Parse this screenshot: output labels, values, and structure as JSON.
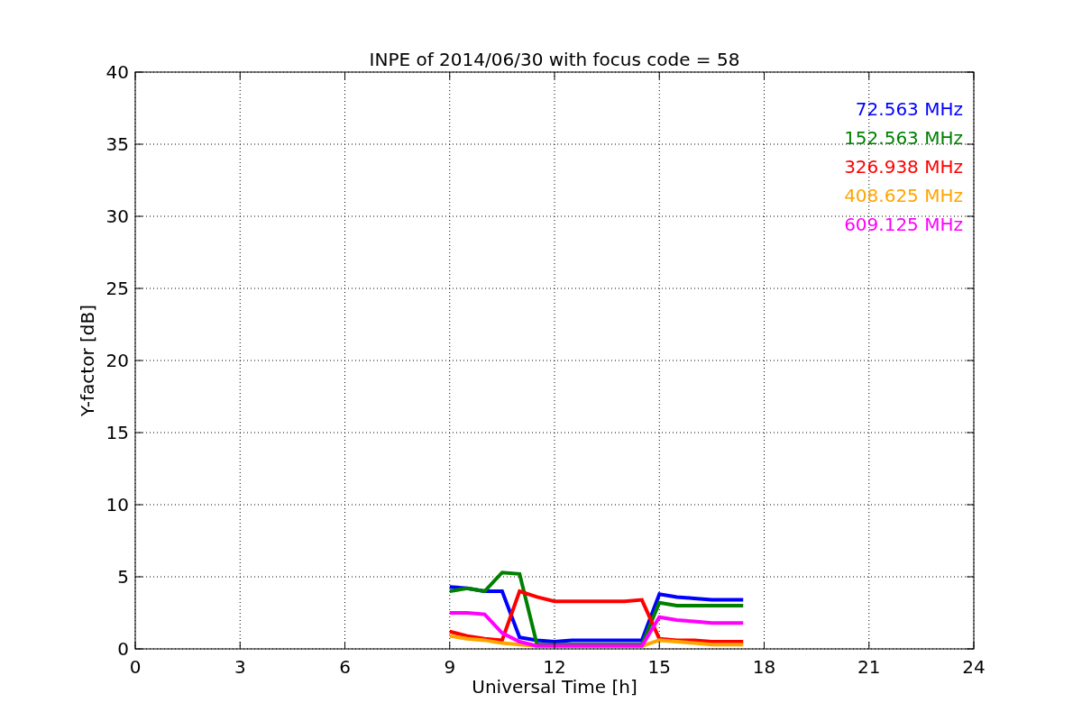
{
  "chart_data": {
    "type": "line",
    "title": "INPE of 2014/06/30 with focus code = 58",
    "xlabel": "Universal Time [h]",
    "ylabel": "Y-factor [dB]",
    "x": [
      9,
      9.5,
      10,
      10.5,
      11,
      11.5,
      12,
      12.5,
      13,
      13.5,
      14,
      14.5,
      15,
      15.5,
      16,
      16.5,
      17,
      17.4
    ],
    "series": [
      {
        "name": "72.563 MHz",
        "color": "#0000ff",
        "values": [
          4.3,
          4.2,
          4.0,
          4.0,
          0.8,
          0.6,
          0.5,
          0.6,
          0.6,
          0.6,
          0.6,
          0.6,
          3.8,
          3.6,
          3.5,
          3.4,
          3.4,
          3.4
        ]
      },
      {
        "name": "152.563 MHz",
        "color": "#008000",
        "values": [
          4.0,
          4.2,
          4.0,
          5.3,
          5.2,
          0.3,
          0.3,
          0.3,
          0.3,
          0.3,
          0.3,
          0.3,
          3.2,
          3.0,
          3.0,
          3.0,
          3.0,
          3.0
        ]
      },
      {
        "name": "326.938 MHz",
        "color": "#ff0000",
        "values": [
          1.2,
          0.9,
          0.7,
          0.6,
          4.0,
          3.6,
          3.3,
          3.3,
          3.3,
          3.3,
          3.3,
          3.4,
          0.7,
          0.6,
          0.6,
          0.5,
          0.5,
          0.5
        ]
      },
      {
        "name": "408.625 MHz",
        "color": "#ffa500",
        "values": [
          0.9,
          0.7,
          0.6,
          0.4,
          0.3,
          0.2,
          null,
          null,
          null,
          null,
          null,
          0.2,
          0.6,
          0.5,
          0.4,
          0.3,
          0.3,
          0.3
        ]
      },
      {
        "name": "609.125 MHz",
        "color": "#ff00ff",
        "values": [
          2.5,
          2.5,
          2.4,
          1.1,
          0.5,
          0.2,
          0.2,
          0.2,
          0.2,
          0.2,
          0.2,
          0.2,
          2.2,
          2.0,
          1.9,
          1.8,
          1.8,
          1.8
        ]
      }
    ],
    "grid": true,
    "xlim": [
      0,
      24
    ],
    "ylim": [
      0,
      40
    ],
    "xticks": [
      0,
      3,
      6,
      9,
      12,
      15,
      18,
      21,
      24
    ],
    "yticks": [
      0,
      5,
      10,
      15,
      20,
      25,
      30,
      35,
      40
    ]
  }
}
